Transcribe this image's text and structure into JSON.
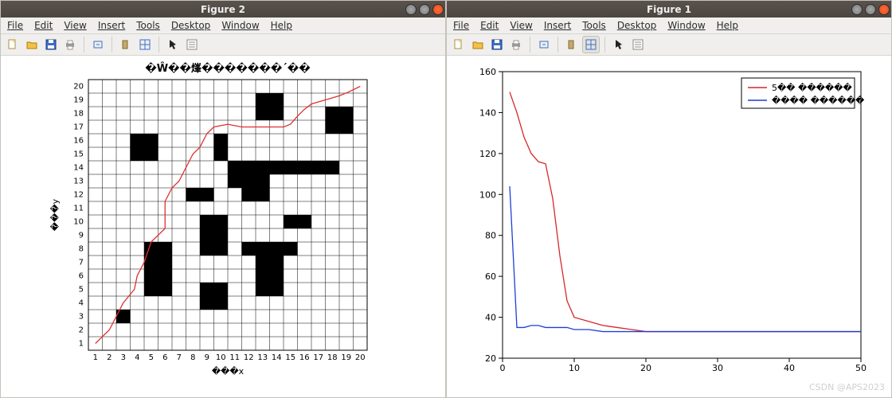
{
  "left_window": {
    "title": "Figure 2",
    "menu": [
      "File",
      "Edit",
      "View",
      "Insert",
      "Tools",
      "Desktop",
      "Window",
      "Help"
    ],
    "buttons": {
      "min": "minimize",
      "max": "maximize",
      "close": "close"
    }
  },
  "right_window": {
    "title": "Figure 1",
    "menu": [
      "File",
      "Edit",
      "View",
      "Insert",
      "Tools",
      "Desktop",
      "Window",
      "Help"
    ],
    "buttons": {
      "min": "minimize",
      "max": "maximize",
      "close": "close"
    }
  },
  "watermark": "CSDN @APS2023",
  "chart_data": [
    {
      "type": "heatmap",
      "title": "�Ŵ��㷨�������´��",
      "xlabel": "���x",
      "ylabel": "���y",
      "xlim": [
        1,
        20
      ],
      "ylim": [
        1,
        20
      ],
      "xticks": [
        1,
        2,
        3,
        4,
        5,
        6,
        7,
        8,
        9,
        10,
        11,
        12,
        13,
        14,
        15,
        16,
        17,
        18,
        19,
        20
      ],
      "yticks": [
        1,
        2,
        3,
        4,
        5,
        6,
        7,
        8,
        9,
        10,
        11,
        12,
        13,
        14,
        15,
        16,
        17,
        18,
        19,
        20
      ],
      "obstacles_xy": [
        [
          3,
          3
        ],
        [
          4,
          15
        ],
        [
          5,
          15
        ],
        [
          4,
          16
        ],
        [
          5,
          16
        ],
        [
          5,
          5
        ],
        [
          5,
          6
        ],
        [
          5,
          7
        ],
        [
          5,
          8
        ],
        [
          6,
          5
        ],
        [
          6,
          6
        ],
        [
          6,
          7
        ],
        [
          6,
          8
        ],
        [
          8,
          12
        ],
        [
          9,
          12
        ],
        [
          9,
          4
        ],
        [
          10,
          4
        ],
        [
          9,
          5
        ],
        [
          10,
          5
        ],
        [
          9,
          10
        ],
        [
          10,
          10
        ],
        [
          9,
          9
        ],
        [
          10,
          9
        ],
        [
          9,
          8
        ],
        [
          10,
          8
        ],
        [
          10,
          15
        ],
        [
          10,
          16
        ],
        [
          11,
          13
        ],
        [
          12,
          13
        ],
        [
          13,
          13
        ],
        [
          11,
          14
        ],
        [
          12,
          14
        ],
        [
          13,
          14
        ],
        [
          14,
          14
        ],
        [
          15,
          14
        ],
        [
          16,
          14
        ],
        [
          17,
          14
        ],
        [
          18,
          14
        ],
        [
          13,
          18
        ],
        [
          13,
          19
        ],
        [
          14,
          18
        ],
        [
          14,
          19
        ],
        [
          12,
          12
        ],
        [
          13,
          12
        ],
        [
          13,
          5
        ],
        [
          13,
          6
        ],
        [
          13,
          7
        ],
        [
          14,
          5
        ],
        [
          14,
          6
        ],
        [
          14,
          7
        ],
        [
          13,
          8
        ],
        [
          14,
          8
        ],
        [
          12,
          8
        ],
        [
          15,
          8
        ],
        [
          15,
          10
        ],
        [
          16,
          10
        ],
        [
          18,
          17
        ],
        [
          19,
          17
        ],
        [
          18,
          18
        ],
        [
          19,
          18
        ]
      ],
      "path_xy": [
        [
          1,
          1
        ],
        [
          2,
          2
        ],
        [
          2.5,
          3
        ],
        [
          3,
          4
        ],
        [
          3.8,
          5
        ],
        [
          4,
          6
        ],
        [
          4.5,
          7
        ],
        [
          5,
          8.5
        ],
        [
          5.5,
          9
        ],
        [
          6,
          9.5
        ],
        [
          6,
          10.5
        ],
        [
          6,
          11.5
        ],
        [
          6.5,
          12.5
        ],
        [
          7,
          13
        ],
        [
          7.5,
          14
        ],
        [
          8,
          15
        ],
        [
          8.5,
          15.5
        ],
        [
          9,
          16.5
        ],
        [
          9.5,
          17
        ],
        [
          10.5,
          17.2
        ],
        [
          11.5,
          17.0
        ],
        [
          12.5,
          17.0
        ],
        [
          13.5,
          17.0
        ],
        [
          14.5,
          17.0
        ],
        [
          15,
          17.2
        ],
        [
          15.5,
          17.8
        ],
        [
          16,
          18.3
        ],
        [
          16.5,
          18.7
        ],
        [
          17.5,
          19
        ],
        [
          18.5,
          19.3
        ],
        [
          19.2,
          19.6
        ],
        [
          20,
          20
        ]
      ]
    },
    {
      "type": "line",
      "xlabel": "",
      "ylabel": "",
      "xlim": [
        0,
        50
      ],
      "ylim": [
        20,
        160
      ],
      "xticks": [
        0,
        10,
        20,
        30,
        40,
        50
      ],
      "yticks": [
        20,
        40,
        60,
        80,
        100,
        120,
        140,
        160
      ],
      "legend_position": "top-right",
      "series": [
        {
          "name": "5�� ������",
          "color": "#d62728",
          "x": [
            1,
            2,
            3,
            4,
            5,
            6,
            7,
            8,
            9,
            10,
            12,
            14,
            16,
            18,
            20,
            25,
            30,
            35,
            40,
            45,
            50
          ],
          "y": [
            150,
            140,
            128,
            120,
            116,
            115,
            98,
            70,
            48,
            40,
            38,
            36,
            35,
            34,
            33,
            33,
            33,
            33,
            33,
            33,
            33
          ]
        },
        {
          "name": "���� ������",
          "color": "#1f3fd6",
          "x": [
            1,
            2,
            3,
            4,
            5,
            6,
            7,
            8,
            9,
            10,
            12,
            14,
            16,
            18,
            20,
            25,
            30,
            35,
            40,
            45,
            50
          ],
          "y": [
            104,
            35,
            35,
            36,
            36,
            35,
            35,
            35,
            35,
            34,
            34,
            33,
            33,
            33,
            33,
            33,
            33,
            33,
            33,
            33,
            33
          ]
        }
      ]
    }
  ]
}
